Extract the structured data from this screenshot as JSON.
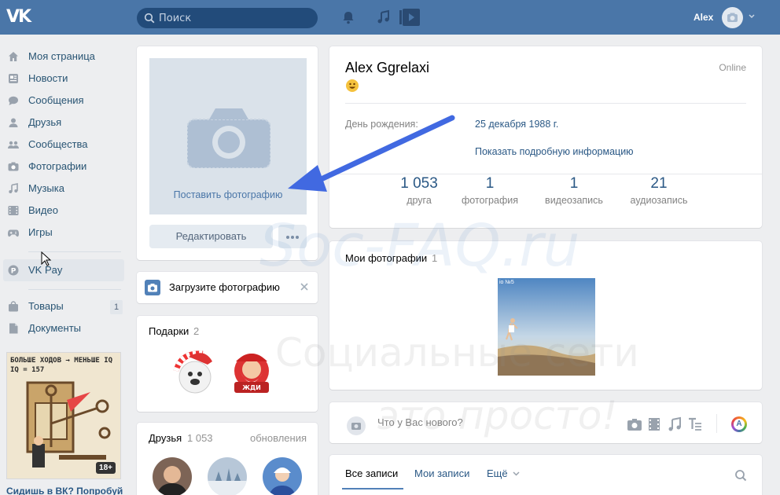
{
  "header": {
    "logo": "VK",
    "search_placeholder": "Поиск",
    "user_name": "Alex"
  },
  "nav": {
    "items": [
      {
        "label": "Моя страница",
        "icon": "home-icon"
      },
      {
        "label": "Новости",
        "icon": "news-icon"
      },
      {
        "label": "Сообщения",
        "icon": "messages-icon"
      },
      {
        "label": "Друзья",
        "icon": "friends-icon"
      },
      {
        "label": "Сообщества",
        "icon": "communities-icon"
      },
      {
        "label": "Фотографии",
        "icon": "camera-icon"
      },
      {
        "label": "Музыка",
        "icon": "music-icon"
      },
      {
        "label": "Видео",
        "icon": "video-icon"
      },
      {
        "label": "Игры",
        "icon": "games-icon"
      }
    ],
    "vkpay": {
      "label": "VK Pay",
      "icon": "vkpay-icon"
    },
    "extra": [
      {
        "label": "Товары",
        "icon": "shop-icon",
        "badge": "1"
      },
      {
        "label": "Документы",
        "icon": "documents-icon"
      }
    ],
    "ad": {
      "line1": "БОЛЬШЕ ХОДОВ → МЕНЬШЕ IQ",
      "line2": "IQ = 157",
      "age": "18+",
      "caption": "Сидишь в ВК? Попробуй"
    }
  },
  "profile_photo": {
    "upload_label": "Поставить фотографию",
    "edit_button": "Редактировать"
  },
  "upload_prompt": {
    "label": "Загрузите фотографию"
  },
  "gifts": {
    "title": "Подарки",
    "count": "2"
  },
  "friends": {
    "title": "Друзья",
    "count": "1 053",
    "updates": "обновления"
  },
  "profile": {
    "name": "Alex Ggrelaxi",
    "status": "Online",
    "birthday_label": "День рождения:",
    "birthday_value": "25 декабря 1988 г.",
    "more_info": "Показать подробную информацию",
    "stats": [
      {
        "n": "1 053",
        "l": "друга"
      },
      {
        "n": "1",
        "l": "фотография"
      },
      {
        "n": "1",
        "l": "видеозапись"
      },
      {
        "n": "21",
        "l": "аудиозапись"
      }
    ]
  },
  "my_photos": {
    "title": "Мои фотографии",
    "count": "1",
    "photo_caption": "io №5"
  },
  "post_box": {
    "placeholder": "Что у Вас нового?",
    "tools": [
      "camera-icon",
      "video-icon",
      "music-icon",
      "text-icon"
    ],
    "avatar_letter": "A"
  },
  "wall_tabs": {
    "all": "Все записи",
    "mine": "Мои записи",
    "more": "Ещё"
  },
  "watermark": {
    "line1": "Soc-FAQ.ru",
    "line2": "Социальные сети",
    "line3": "это просто!"
  },
  "colors": {
    "header": "#4a76a8",
    "accent": "#2a5885",
    "arrow": "#4169e1"
  }
}
